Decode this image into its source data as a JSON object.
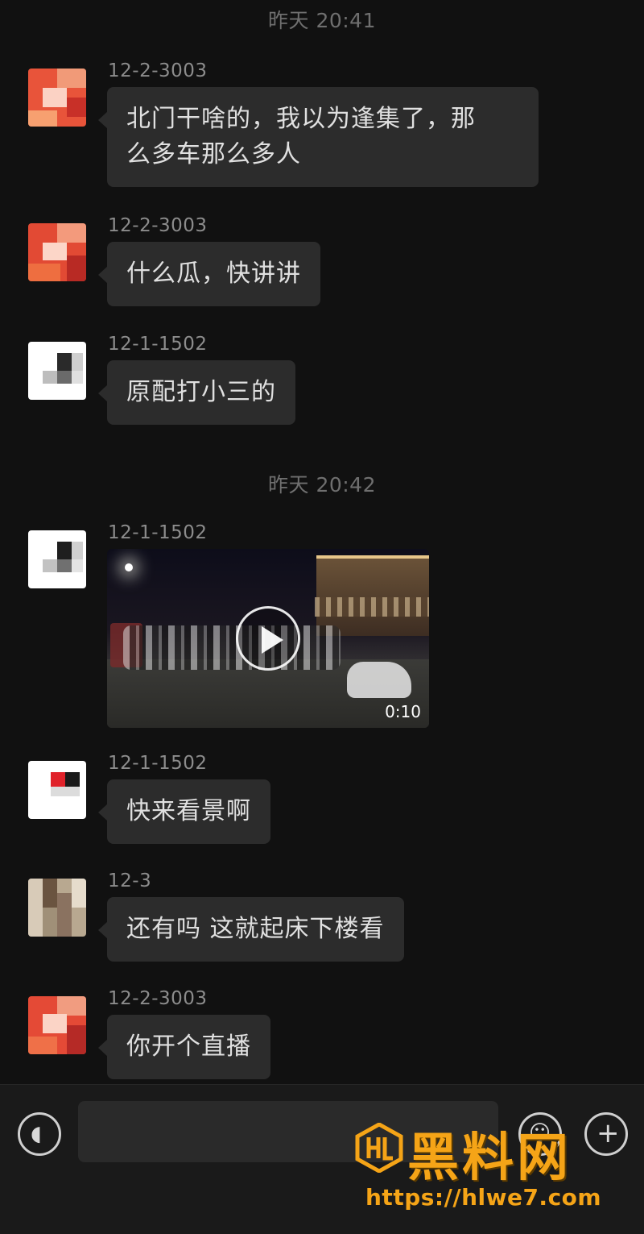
{
  "time_dividers": [
    "昨天 20:41",
    "昨天 20:42"
  ],
  "messages": [
    {
      "sender": "12-2-3003",
      "lines": [
        "北门干啥的，我以为逢集了，那",
        "么多车那么多人"
      ]
    },
    {
      "sender": "12-2-3003",
      "lines": [
        "什么瓜，快讲讲"
      ]
    },
    {
      "sender": "12-1-1502",
      "lines": [
        "原配打小三的"
      ]
    },
    {
      "sender": "12-1-1502",
      "video_duration": "0:10"
    },
    {
      "sender": "12-1-1502",
      "lines": [
        "快来看景啊"
      ]
    },
    {
      "sender": "12-3",
      "lines": [
        "还有吗 这就起床下楼看"
      ]
    },
    {
      "sender": "12-2-3003",
      "lines": [
        "你开个直播"
      ]
    }
  ],
  "input_bar": {
    "voice_icon": "voice-icon",
    "emoji_icon": "emoji-icon",
    "plus_icon": "plus-icon",
    "input_value": ""
  },
  "watermark": {
    "name": "黑料网",
    "url": "https://hlwe7.com"
  },
  "colors": {
    "background": "#111111",
    "bubble": "#2c2c2c",
    "text": "#e0e0e0",
    "meta": "#8c8c8c",
    "watermark": "#f5a417"
  }
}
